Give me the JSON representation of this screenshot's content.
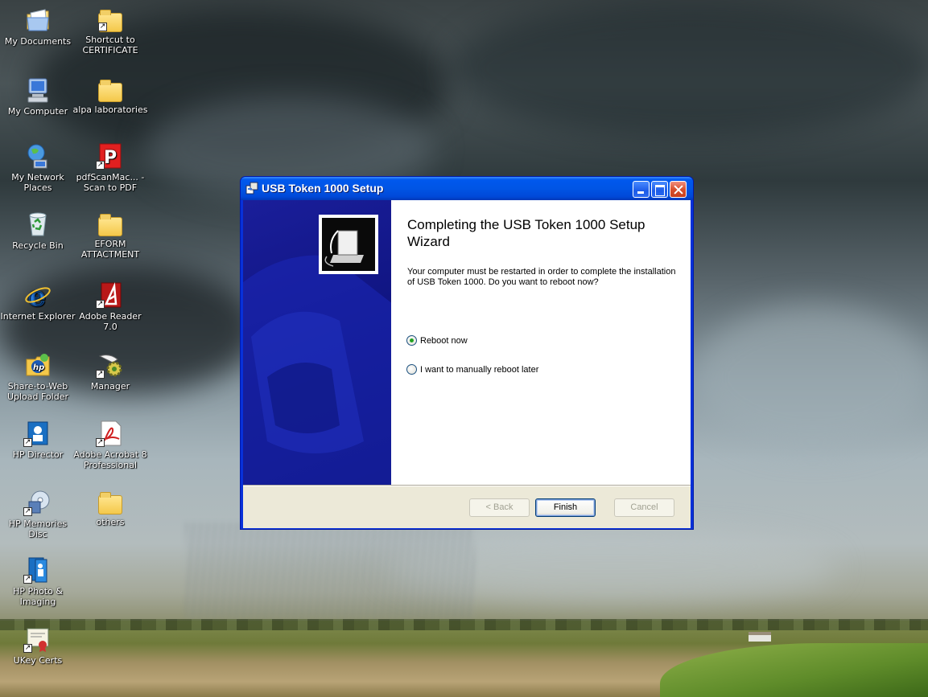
{
  "desktop": {
    "icons": [
      {
        "label": "My Documents"
      },
      {
        "label": "Shortcut to CERTIFICATE"
      },
      {
        "label": "My Computer"
      },
      {
        "label": "alpa laboratories"
      },
      {
        "label": "My Network Places"
      },
      {
        "label": "pdfScanMac... - Scan to PDF"
      },
      {
        "label": "Recycle Bin"
      },
      {
        "label": "EFORM ATTACTMENT"
      },
      {
        "label": "Internet Explorer"
      },
      {
        "label": "Adobe Reader 7.0"
      },
      {
        "label": "Share-to-Web Upload Folder"
      },
      {
        "label": "Manager"
      },
      {
        "label": "HP Director"
      },
      {
        "label": "Adobe Acrobat 8 Professional"
      },
      {
        "label": "HP Memories Disc"
      },
      {
        "label": "others"
      },
      {
        "label": "HP Photo & Imaging"
      },
      {
        "label": "UKey Certs"
      }
    ]
  },
  "dialog": {
    "title": "USB Token 1000 Setup",
    "heading": "Completing the USB Token 1000 Setup Wizard",
    "body": "Your computer must be restarted in order to complete the installation of USB Token 1000. Do you want to reboot now?",
    "options": [
      {
        "label": "Reboot now",
        "selected": true
      },
      {
        "label": "I want to manually reboot later",
        "selected": false
      }
    ],
    "buttons": {
      "back": "< Back",
      "finish": "Finish",
      "cancel": "Cancel"
    }
  },
  "colors": {
    "titlebar": "#0055e5",
    "banner": "#0f1480",
    "selected_radio": "#21a121"
  }
}
